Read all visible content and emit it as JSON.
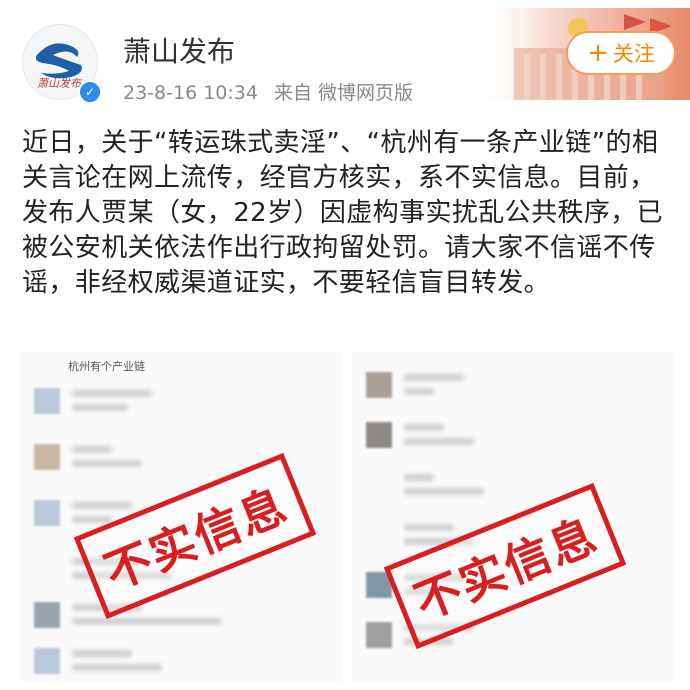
{
  "account": {
    "name": "萧山发布",
    "avatar_text": "萧山发布",
    "verified_icon": "verified-badge"
  },
  "meta": {
    "timestamp": "23-8-16 10:34",
    "source": "来自 微博网页版"
  },
  "follow": {
    "plus": "+",
    "label": "关注"
  },
  "post": {
    "text": "近日，关于“转运珠式卖淫”、“杭州有一条产业链”的相关言论在网上流传，经官方核实，系不实信息。目前，发布人贾某（女，22岁）因虚构事实扰乱公共秩序，已被公安机关依法作出行政拘留处罚。请大家不信谣不传谣，非经权威渠道证实，不要轻信盲目转发。"
  },
  "images": {
    "left_title": "杭州有个产业链",
    "stamp_left": "不实信息",
    "stamp_right": "不实信息"
  },
  "colors": {
    "accent": "#ff8200",
    "stamp": "#d81e1e",
    "verified": "#2d8cf0"
  }
}
